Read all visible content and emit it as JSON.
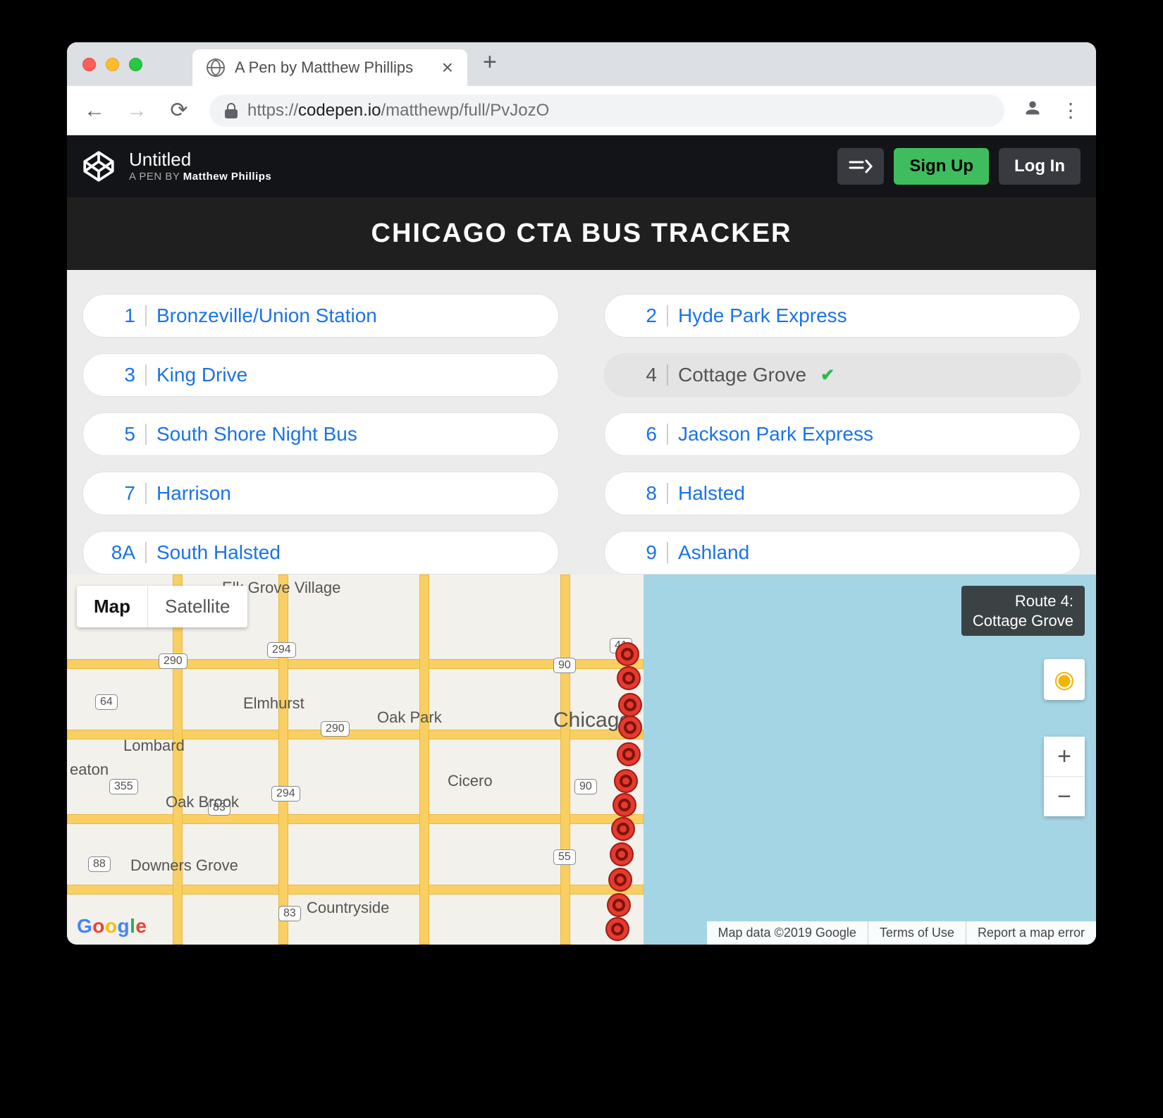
{
  "browser": {
    "tab_title": "A Pen by Matthew Phillips",
    "url_scheme": "https://",
    "url_host": "codepen.io",
    "url_path": "/matthewp/full/PvJozO"
  },
  "codepen": {
    "title": "Untitled",
    "subtitle_prefix": "A PEN BY ",
    "subtitle_author": "Matthew Phillips",
    "signup_label": "Sign Up",
    "login_label": "Log In"
  },
  "app": {
    "title": "CHICAGO CTA BUS TRACKER"
  },
  "routes": [
    {
      "num": "1",
      "name": "Bronzeville/Union Station",
      "selected": false
    },
    {
      "num": "2",
      "name": "Hyde Park Express",
      "selected": false
    },
    {
      "num": "3",
      "name": "King Drive",
      "selected": false
    },
    {
      "num": "4",
      "name": "Cottage Grove",
      "selected": true
    },
    {
      "num": "5",
      "name": "South Shore Night Bus",
      "selected": false
    },
    {
      "num": "6",
      "name": "Jackson Park Express",
      "selected": false
    },
    {
      "num": "7",
      "name": "Harrison",
      "selected": false
    },
    {
      "num": "8",
      "name": "Halsted",
      "selected": false
    },
    {
      "num": "8A",
      "name": "South Halsted",
      "selected": false
    },
    {
      "num": "9",
      "name": "Ashland",
      "selected": false
    }
  ],
  "map": {
    "type_map": "Map",
    "type_satellite": "Satellite",
    "badge_line1": "Route 4:",
    "badge_line2": "Cottage Grove",
    "attribution": "Map data ©2019 Google",
    "terms": "Terms of Use",
    "report": "Report a map error",
    "shields": [
      "290",
      "294",
      "90",
      "41",
      "64",
      "355",
      "83",
      "294",
      "88",
      "290",
      "83",
      "55",
      "90"
    ],
    "labels": {
      "elkgrove": "Elk Grove Village",
      "elmhurst": "Elmhurst",
      "lombard": "Lombard",
      "eaton": "eaton",
      "oakbrook": "Oak Brook",
      "downers": "Downers Grove",
      "oakpark": "Oak Park",
      "cicero": "Cicero",
      "chicago": "Chicago",
      "countryside": "Countryside"
    }
  }
}
